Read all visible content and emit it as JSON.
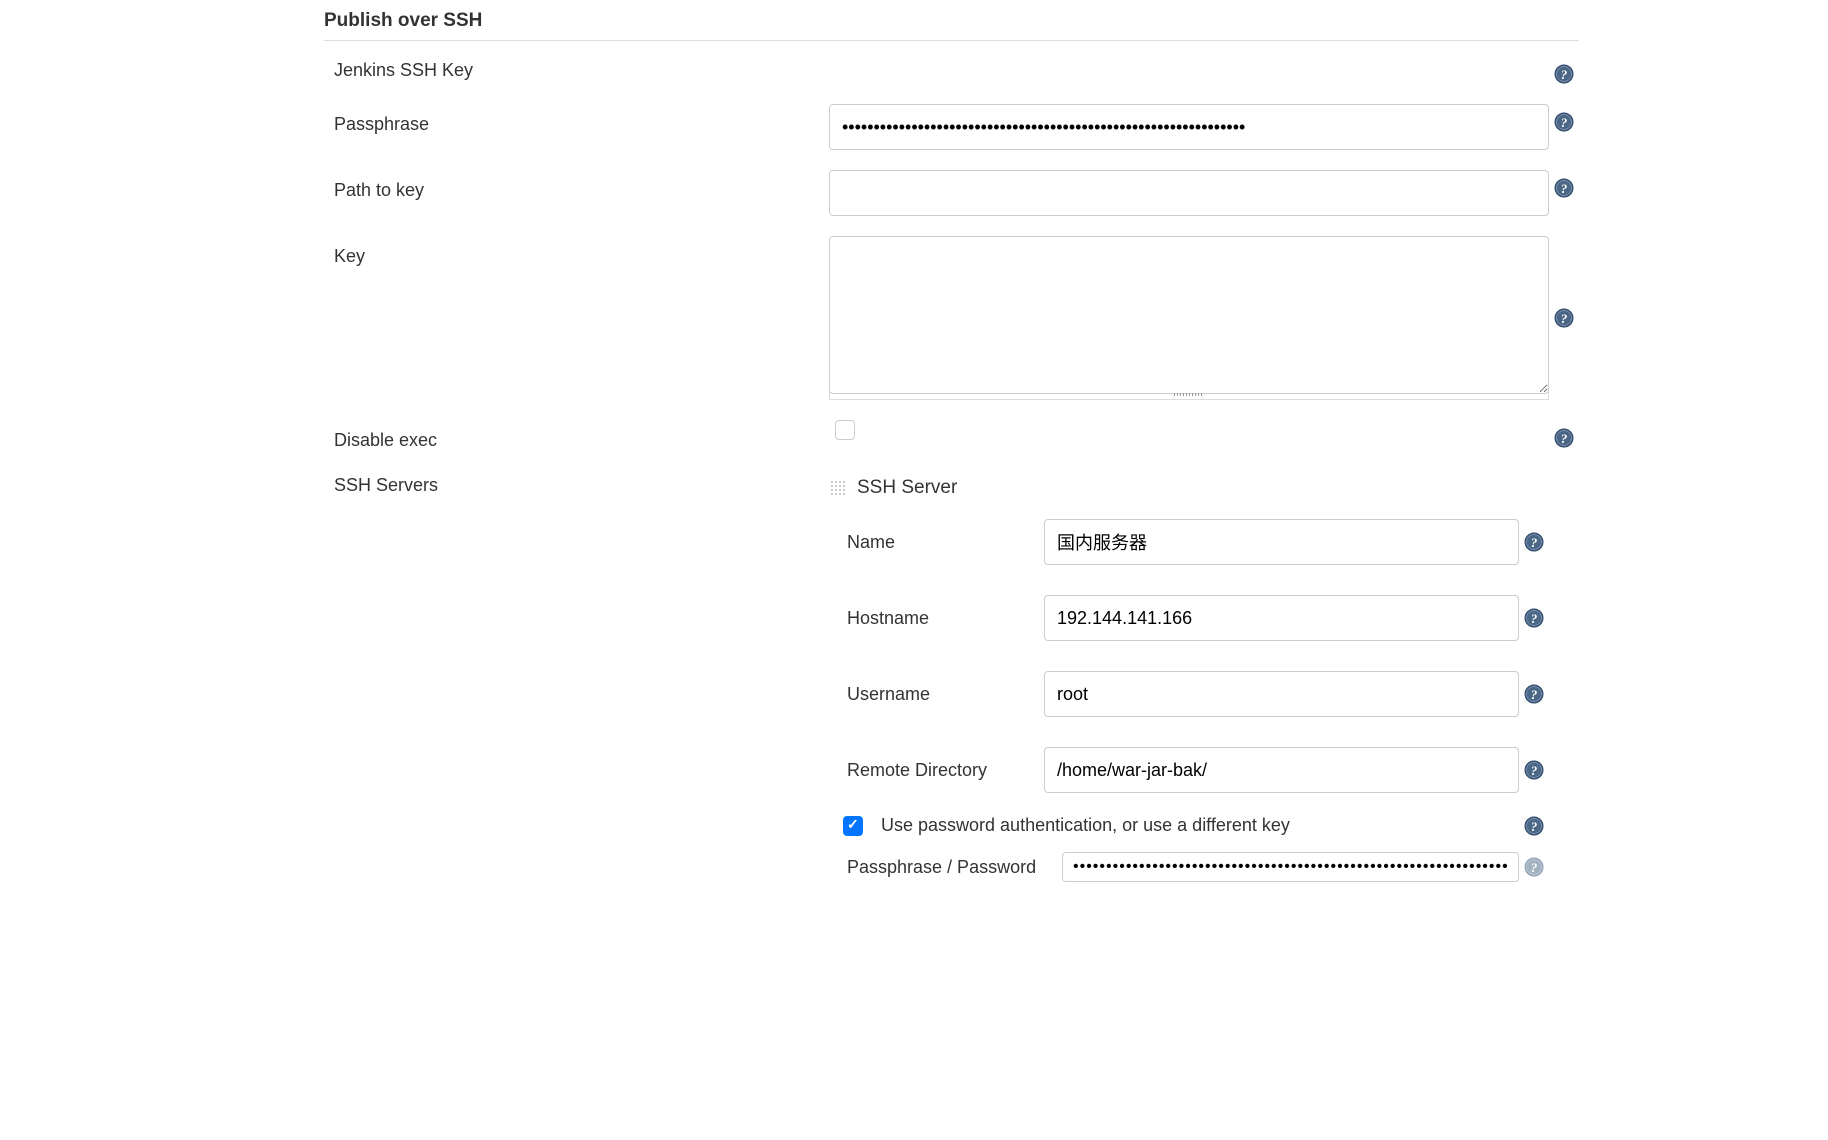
{
  "section": {
    "title": "Publish over SSH"
  },
  "fields": {
    "jenkinsSshKey": {
      "label": "Jenkins SSH Key"
    },
    "passphrase": {
      "label": "Passphrase",
      "value": "••••••••••••••••••••••••••••••••••••••••••••••••••••••••••••••••"
    },
    "pathToKey": {
      "label": "Path to key",
      "value": ""
    },
    "key": {
      "label": "Key",
      "value": ""
    },
    "disableExec": {
      "label": "Disable exec",
      "checked": false
    },
    "sshServers": {
      "label": "SSH Servers"
    }
  },
  "sshServer": {
    "title": "SSH Server",
    "name": {
      "label": "Name",
      "value": "国内服务器"
    },
    "hostname": {
      "label": "Hostname",
      "value": "192.144.141.166"
    },
    "username": {
      "label": "Username",
      "value": "root"
    },
    "remoteDirectory": {
      "label": "Remote Directory",
      "value": "/home/war-jar-bak/"
    },
    "usePassword": {
      "label": "Use password authentication, or use a different key",
      "checked": true
    },
    "passphrasePassword": {
      "label": "Passphrase / Password",
      "value": "••••••••••••••••••••••••••••••••••••••••••••••••••••••••••••••••••••••••••••••••••••••••••"
    }
  }
}
